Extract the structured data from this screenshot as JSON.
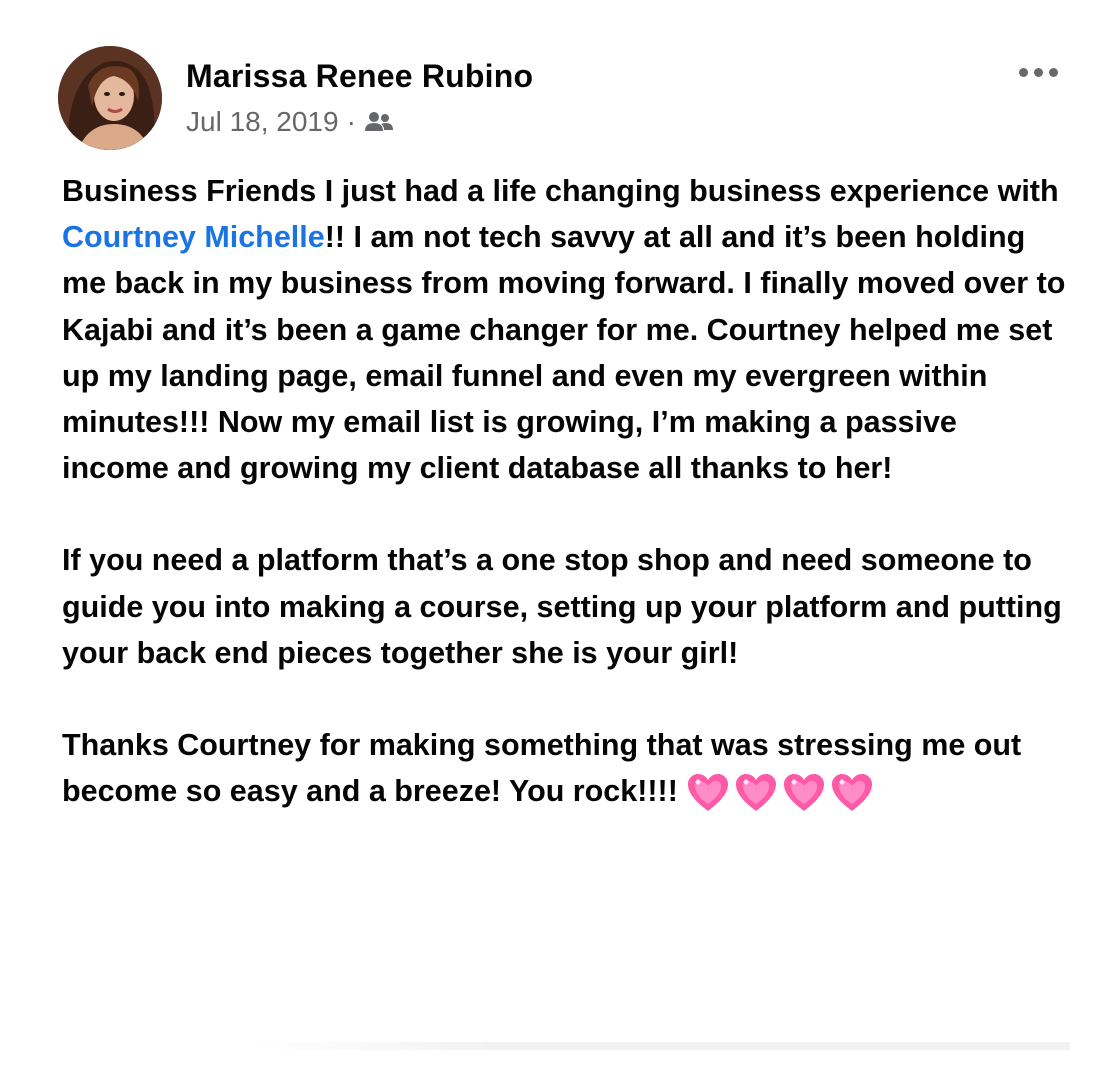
{
  "post": {
    "author": "Marissa Renee Rubino",
    "date": "Jul 18, 2019",
    "separator": "·",
    "audience_icon": "friends-icon",
    "more_icon": "more-options-icon",
    "paragraph1_start": "Business Friends I just had a life changing business experience with ",
    "mention": "Courtney Michelle",
    "paragraph1_end": "!! I am not tech savvy at all and it’s been holding me back in my business from moving forward. I finally moved over to Kajabi and it’s been a game changer for me. Courtney helped me set up my landing page, email funnel and even my evergreen within minutes!!! Now my email list is growing, I’m making a passive income and growing my client database all thanks to her!",
    "paragraph2": "If you need a platform that’s a one stop shop and need someone to guide you into making a course, setting up your platform and putting your back end pieces together she is your girl!",
    "paragraph3": "Thanks Courtney for making something that was stressing me out become so easy and a breeze! You rock!!!!",
    "emoji_icon": "sparkling-heart-icon",
    "mention_color": "#1b74e4",
    "heart_color": "#ff5aa8"
  }
}
